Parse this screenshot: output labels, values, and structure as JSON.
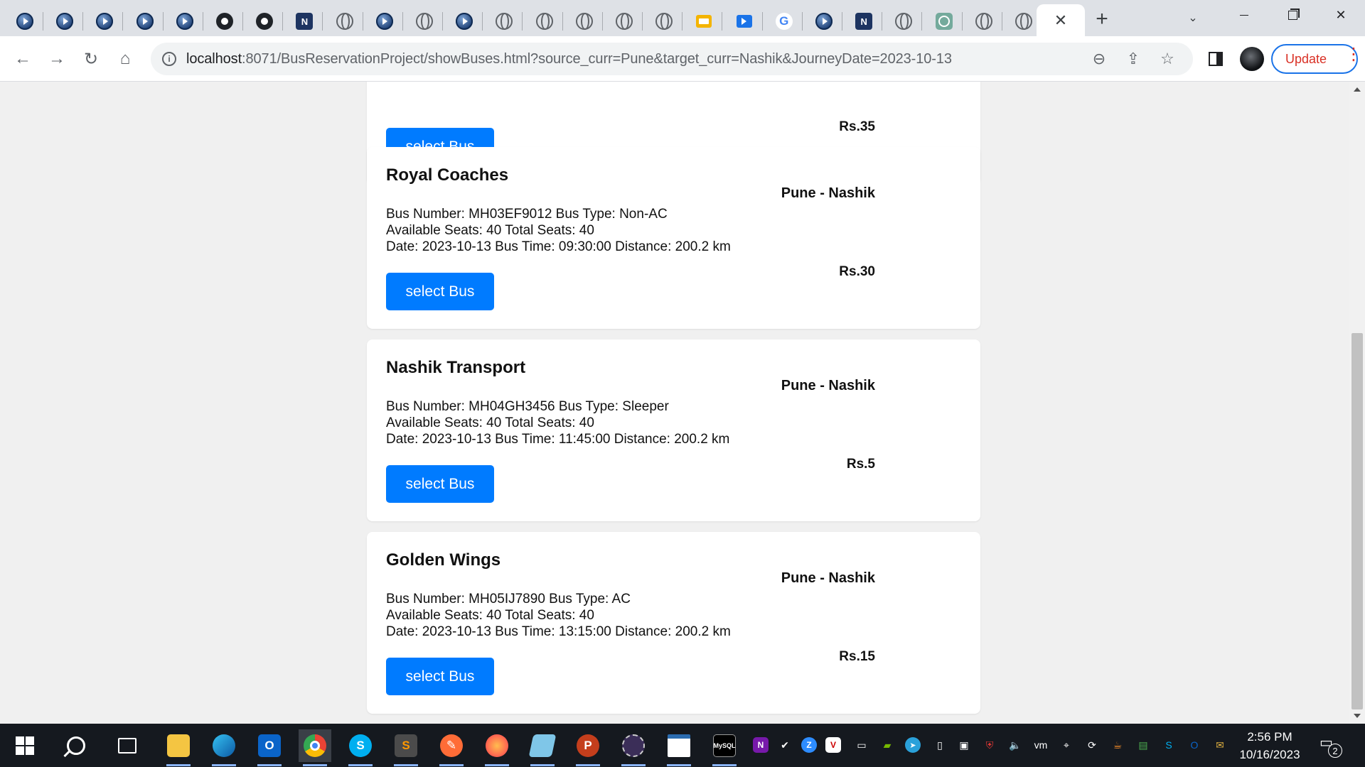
{
  "browser": {
    "tabs": [
      {
        "icon": "play-circle-icon"
      },
      {
        "icon": "play-circle-icon"
      },
      {
        "icon": "play-circle-icon"
      },
      {
        "icon": "play-circle-icon"
      },
      {
        "icon": "play-circle-icon"
      },
      {
        "icon": "github-icon"
      },
      {
        "icon": "github-icon"
      },
      {
        "icon": "brand-logo-icon"
      },
      {
        "icon": "globe-icon"
      },
      {
        "icon": "play-circle-icon"
      },
      {
        "icon": "globe-icon"
      },
      {
        "icon": "play-circle-icon"
      },
      {
        "icon": "globe-icon"
      },
      {
        "icon": "globe-icon"
      },
      {
        "icon": "globe-icon"
      },
      {
        "icon": "globe-icon"
      },
      {
        "icon": "globe-icon"
      },
      {
        "icon": "slides-icon"
      },
      {
        "icon": "video-icon"
      },
      {
        "icon": "google-icon"
      },
      {
        "icon": "play-circle-icon"
      },
      {
        "icon": "brand-logo-icon"
      },
      {
        "icon": "globe-icon"
      },
      {
        "icon": "chatgpt-icon"
      },
      {
        "icon": "globe-icon"
      },
      {
        "icon": "globe-icon"
      }
    ],
    "active_tab_close": "✕",
    "new_tab": "+",
    "url_host": "localhost",
    "url_rest": ":8071/BusReservationProject/showBuses.html?source_curr=Pune&target_curr=Nashik&JourneyDate=2023-10-13",
    "update_label": "Update"
  },
  "page": {
    "partial_card": {
      "button_label": "select Bus",
      "fare": "Rs.35"
    },
    "buses": [
      {
        "name": "Royal Coaches",
        "route": "Pune - Nashik",
        "line1": "Bus Number: MH03EF9012 Bus Type: Non-AC",
        "line2": "Available Seats: 40 Total Seats: 40",
        "line3": "Date: 2023-10-13 Bus Time: 09:30:00 Distance: 200.2 km",
        "fare": "Rs.30",
        "button_label": "select Bus"
      },
      {
        "name": "Nashik Transport",
        "route": "Pune - Nashik",
        "line1": "Bus Number: MH04GH3456 Bus Type: Sleeper",
        "line2": "Available Seats: 40 Total Seats: 40",
        "line3": "Date: 2023-10-13 Bus Time: 11:45:00 Distance: 200.2 km",
        "fare": "Rs.5",
        "button_label": "select Bus"
      },
      {
        "name": "Golden Wings",
        "route": "Pune - Nashik",
        "line1": "Bus Number: MH05IJ7890 Bus Type: AC",
        "line2": "Available Seats: 40 Total Seats: 40",
        "line3": "Date: 2023-10-13 Bus Time: 13:15:00 Distance: 200.2 km",
        "fare": "Rs.15",
        "button_label": "select Bus"
      }
    ]
  },
  "taskbar": {
    "time": "2:56 PM",
    "date": "10/16/2023",
    "notification_count": "2"
  },
  "colors": {
    "accent": "#007bff",
    "page_bg": "#f0f0f0",
    "taskbar_bg": "#15191f"
  }
}
